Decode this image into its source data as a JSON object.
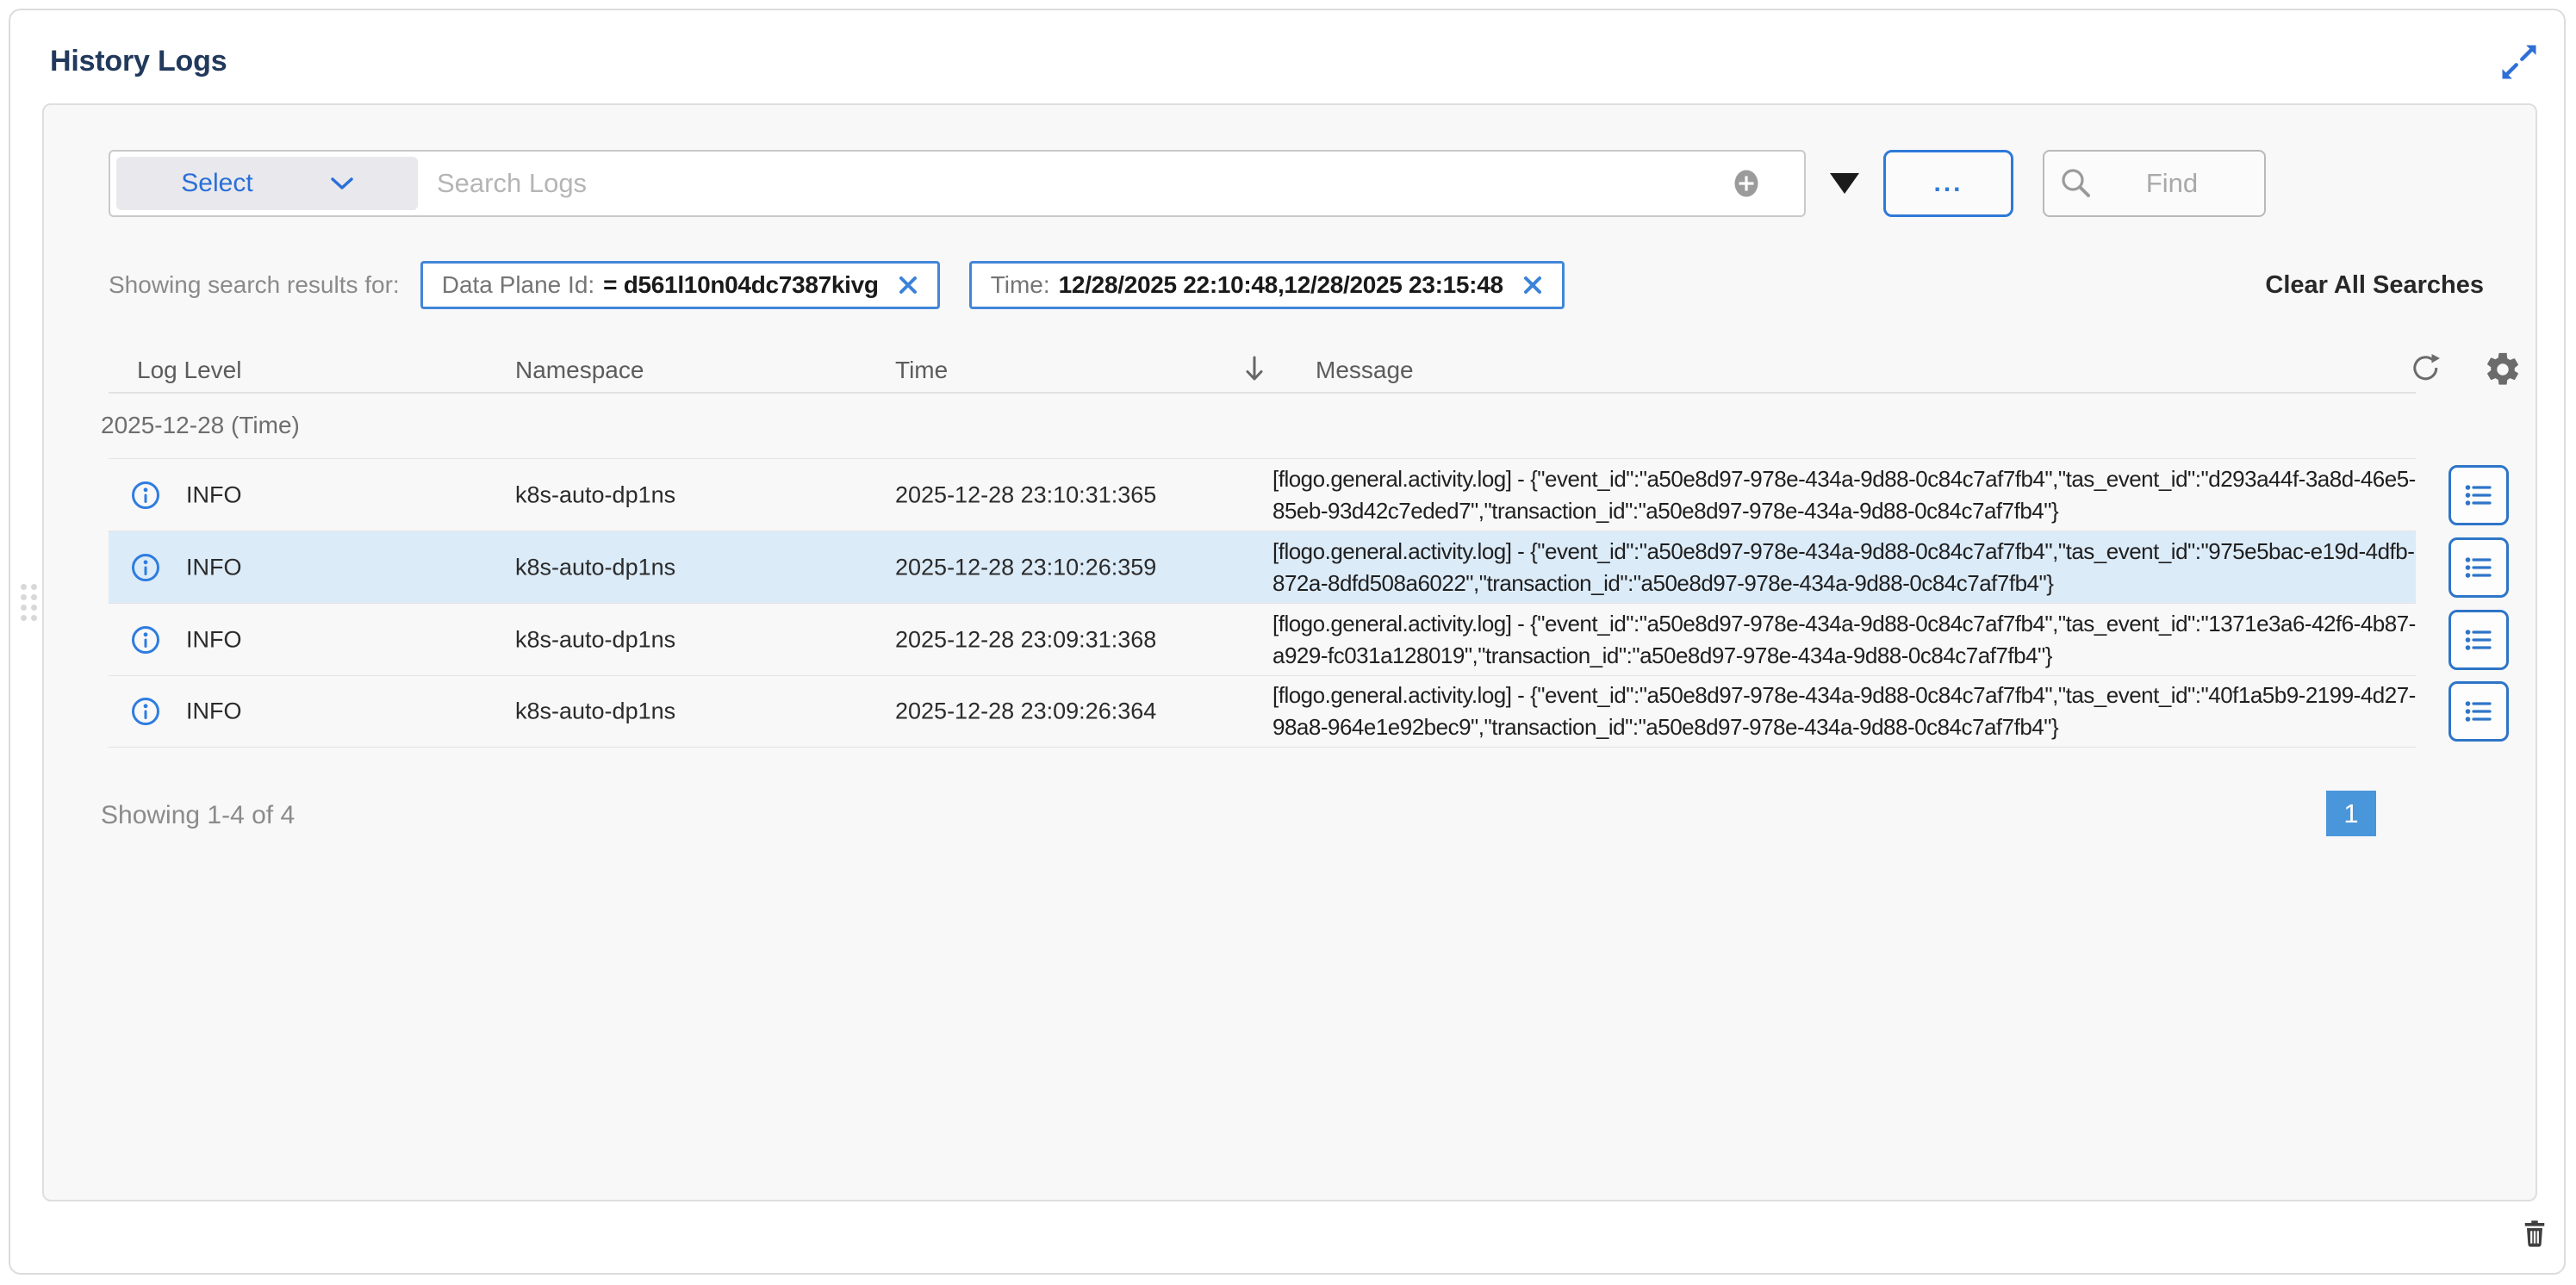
{
  "panel": {
    "title": "History Logs"
  },
  "search": {
    "select_label": "Select",
    "placeholder": "Search Logs",
    "more_label": "...",
    "find_placeholder": "Find"
  },
  "filters": {
    "label": "Showing search results for:",
    "chips": [
      {
        "name": "Data Plane Id:",
        "value": "= d561l10n04dc7387kivg"
      },
      {
        "name": "Time:",
        "value": "12/28/2025 22:10:48,12/28/2025 23:15:48"
      }
    ],
    "clear_all": "Clear All Searches"
  },
  "table": {
    "columns": {
      "level": "Log Level",
      "namespace": "Namespace",
      "time": "Time",
      "message": "Message"
    },
    "group": "2025-12-28 (Time)",
    "rows": [
      {
        "level": "INFO",
        "namespace": "k8s-auto-dp1ns",
        "time": "2025-12-28 23:10:31:365",
        "message": "[flogo.general.activity.log] - {\"event_id\":\"a50e8d97-978e-434a-9d88-0c84c7af7fb4\",\"tas_event_id\":\"d293a44f-3a8d-46e5-85eb-93d42c7eded7\",\"transaction_id\":\"a50e8d97-978e-434a-9d88-0c84c7af7fb4\"}"
      },
      {
        "level": "INFO",
        "namespace": "k8s-auto-dp1ns",
        "time": "2025-12-28 23:10:26:359",
        "message": "[flogo.general.activity.log] - {\"event_id\":\"a50e8d97-978e-434a-9d88-0c84c7af7fb4\",\"tas_event_id\":\"975e5bac-e19d-4dfb-872a-8dfd508a6022\",\"transaction_id\":\"a50e8d97-978e-434a-9d88-0c84c7af7fb4\"}"
      },
      {
        "level": "INFO",
        "namespace": "k8s-auto-dp1ns",
        "time": "2025-12-28 23:09:31:368",
        "message": "[flogo.general.activity.log] - {\"event_id\":\"a50e8d97-978e-434a-9d88-0c84c7af7fb4\",\"tas_event_id\":\"1371e3a6-42f6-4b87-a929-fc031a128019\",\"transaction_id\":\"a50e8d97-978e-434a-9d88-0c84c7af7fb4\"}"
      },
      {
        "level": "INFO",
        "namespace": "k8s-auto-dp1ns",
        "time": "2025-12-28 23:09:26:364",
        "message": "[flogo.general.activity.log] - {\"event_id\":\"a50e8d97-978e-434a-9d88-0c84c7af7fb4\",\"tas_event_id\":\"40f1a5b9-2199-4d27-98a8-964e1e92bec9\",\"transaction_id\":\"a50e8d97-978e-434a-9d88-0c84c7af7fb4\"}"
      }
    ]
  },
  "pagination": {
    "summary": "Showing 1-4 of 4",
    "page": "1"
  },
  "icons": {
    "expand": "expand-arrows-icon",
    "add": "plus-circle-icon",
    "caret": "caret-down-icon",
    "find": "search-icon",
    "remove_chip": "close-icon",
    "sort": "arrow-down-icon",
    "refresh": "refresh-icon",
    "settings": "gear-icon",
    "info": "info-circle-icon",
    "details": "list-icon",
    "drag": "drag-handle-icon",
    "delete": "trash-icon"
  },
  "colors": {
    "accent_blue": "#2e7ce0",
    "chip_border": "#4286d8",
    "row_highlight": "#dcebf8",
    "page_active": "#4a96db",
    "title_navy": "#21395c"
  }
}
